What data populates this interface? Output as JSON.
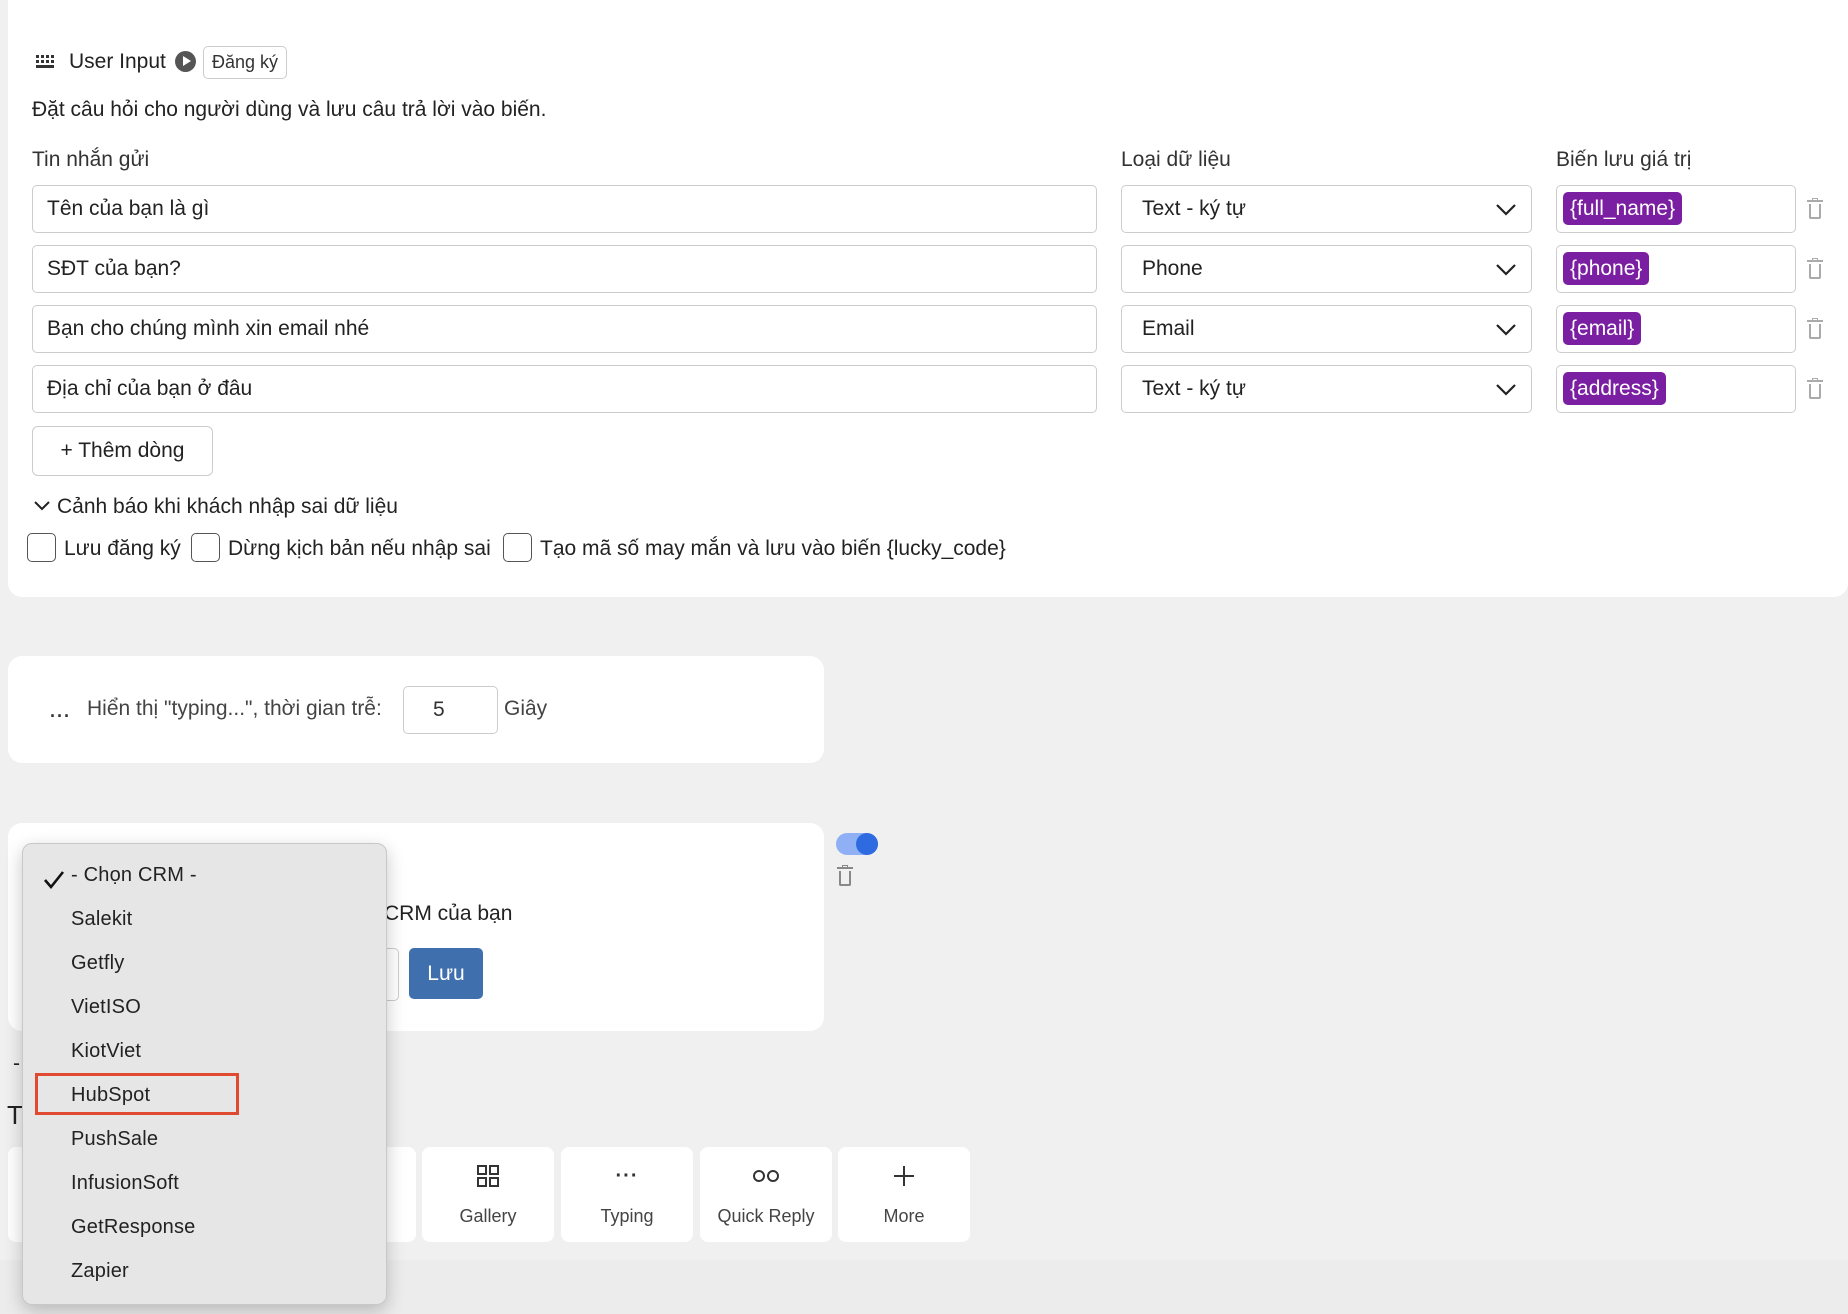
{
  "user_input": {
    "title": "User Input",
    "badge": "Đăng ký",
    "description": "Đặt câu hỏi cho người dùng và lưu câu trả lời vào biến.",
    "columns": {
      "message": "Tin nhắn gửi",
      "data_type": "Loại dữ liệu",
      "variable": "Biến lưu giá trị"
    },
    "rows": [
      {
        "message": "Tên của bạn là gì",
        "data_type": "Text - ký tự",
        "variable": "{full_name}"
      },
      {
        "message": "SĐT của bạn?",
        "data_type": "Phone",
        "variable": "{phone}"
      },
      {
        "message": "Bạn cho chúng mình xin email nhé",
        "data_type": "Email",
        "variable": "{email}"
      },
      {
        "message": "Địa chỉ của bạn ở đâu",
        "data_type": "Text - ký tự",
        "variable": "{address}"
      }
    ],
    "add_row_label": "+ Thêm dòng",
    "warning_toggle_label": "Cảnh báo khi khách nhập sai dữ liệu",
    "checkboxes": [
      {
        "label": "Lưu đăng ký",
        "checked": false
      },
      {
        "label": "Dừng kịch bản nếu nhập sai",
        "checked": false
      },
      {
        "label": "Tạo mã số may mắn và lưu vào biến {lucky_code}",
        "checked": false
      }
    ]
  },
  "typing": {
    "label": "Hiển thị \"typing...\", thời gian trễ:",
    "delay_value": "5",
    "unit": "Giây"
  },
  "crm": {
    "text_partial": "CRM của bạn",
    "save_label": "Lưu",
    "toggle_on": true
  },
  "partial_behind": {
    "dash": "-",
    "letter": "T"
  },
  "toolbar": {
    "tiles": [
      {
        "label": "Gallery",
        "icon": "grid-icon"
      },
      {
        "label": "Typing",
        "icon": "dots-icon"
      },
      {
        "label": "Quick Reply",
        "icon": "quick-reply-icon"
      },
      {
        "label": "More",
        "icon": "plus-icon"
      }
    ]
  },
  "crm_dropdown": {
    "selected": "- Chọn CRM -",
    "options": [
      "- Chọn CRM -",
      "Salekit",
      "Getfly",
      "VietISO",
      "KiotViet",
      "HubSpot",
      "PushSale",
      "InfusionSoft",
      "GetResponse",
      "Zapier"
    ],
    "highlighted": "HubSpot",
    "highlight_color": "#e04a30"
  },
  "colors": {
    "variable_tag": "#7b1fa2",
    "save_button": "#3f6fad",
    "toggle_track": "#8fb0f5",
    "toggle_knob": "#2f6be0"
  }
}
